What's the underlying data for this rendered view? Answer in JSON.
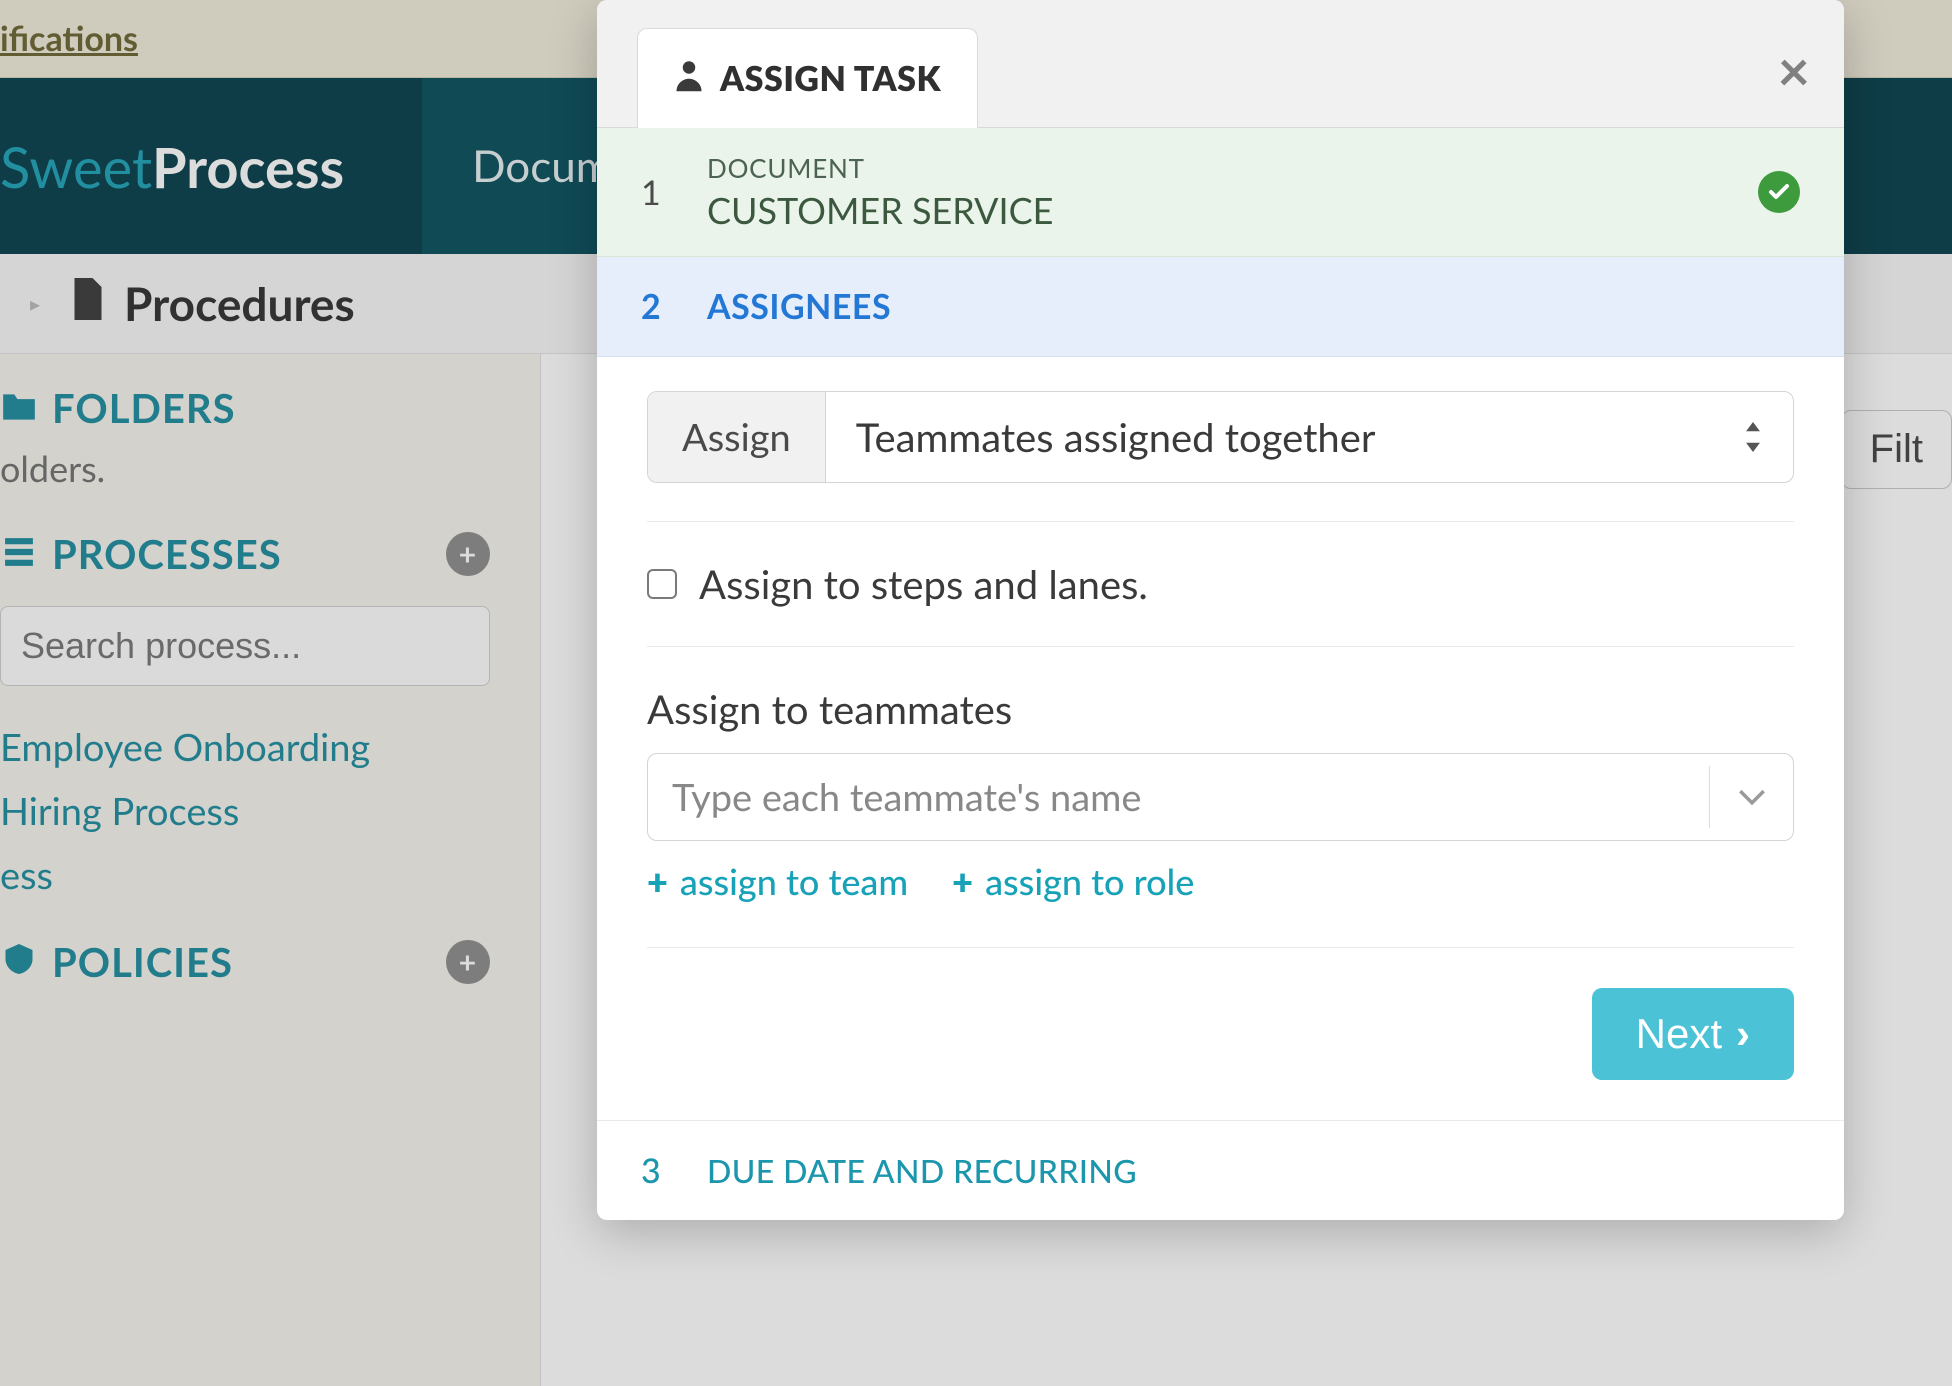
{
  "topbar": {
    "link_text": "ifications"
  },
  "brand": {
    "part1": "Sweet",
    "part2": "Process"
  },
  "nav": {
    "documents": "Docume"
  },
  "breadcrumb": {
    "title": "Procedures"
  },
  "sidebar": {
    "folders": {
      "title": "FOLDERS",
      "subtitle": "olders."
    },
    "processes": {
      "title": "PROCESSES",
      "search_placeholder": "Search process...",
      "items": [
        "Employee Onboarding",
        "Hiring Process",
        "ess"
      ]
    },
    "policies": {
      "title": "POLICIES"
    }
  },
  "content": {
    "filter_button": "Filt"
  },
  "modal": {
    "tab_title": "ASSIGN TASK",
    "step1": {
      "num": "1",
      "label_small": "DOCUMENT",
      "label_large": "CUSTOMER SERVICE"
    },
    "step2": {
      "num": "2",
      "title": "ASSIGNEES",
      "assign_label": "Assign",
      "assign_value": "Teammates assigned together",
      "checkbox_label": "Assign to steps and lanes.",
      "teammates_label": "Assign to teammates",
      "teammates_placeholder": "Type each teammate's name",
      "assign_team": "assign to team",
      "assign_role": "assign to role",
      "next": "Next"
    },
    "step3": {
      "num": "3",
      "title": "DUE DATE AND RECURRING"
    }
  }
}
